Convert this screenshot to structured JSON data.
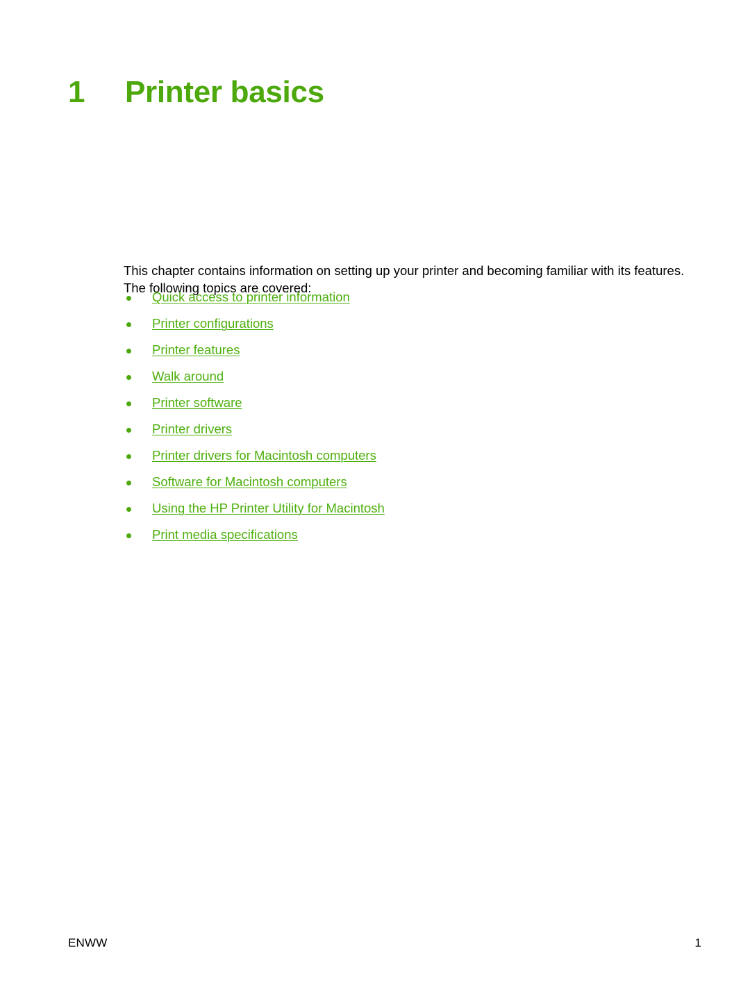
{
  "document": {
    "page_background": "#ffffff",
    "accent_color": "#4CA80B",
    "link_color": "#4CAF0C",
    "text_color": "#000000"
  },
  "heading": {
    "number": "1",
    "title": "Printer basics"
  },
  "intro": {
    "paragraph": "This chapter contains information on setting up your printer and becoming familiar with its features. The following topics are covered:"
  },
  "topics": [
    {
      "label": "Quick access to printer information"
    },
    {
      "label": "Printer configurations"
    },
    {
      "label": "Printer features"
    },
    {
      "label": "Walk around"
    },
    {
      "label": "Printer software"
    },
    {
      "label": "Printer drivers"
    },
    {
      "label": "Printer drivers for Macintosh computers"
    },
    {
      "label": "Software for Macintosh computers"
    },
    {
      "label": "Using the HP Printer Utility for Macintosh"
    },
    {
      "label": "Print media specifications"
    }
  ],
  "footer": {
    "left": "ENWW",
    "page_number": "1"
  }
}
